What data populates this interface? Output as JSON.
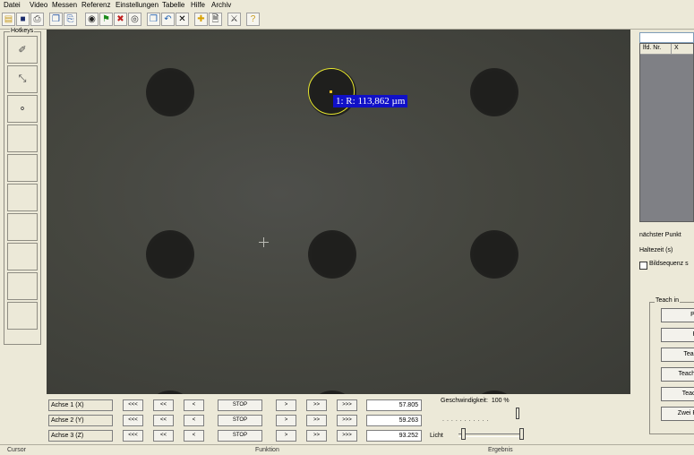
{
  "menu": [
    "Datei",
    "Video",
    "Messen",
    "Referenz",
    "Einstellungen",
    "Tabelle",
    "Hilfe",
    "Archiv"
  ],
  "toolbar_icons": [
    "open-folder-icon",
    "save-disk-icon",
    "print-icon",
    "copy-icon",
    "paste-icon",
    "camera-icon",
    "flag-icon",
    "marker-icon",
    "record-icon",
    "measure-icon",
    "undo-icon",
    "delete-x-icon",
    "crosshair-icon",
    "page-search-icon",
    "network-icon",
    "help-icon"
  ],
  "hotkeys": {
    "title": "Hotkeys",
    "buttons": [
      {
        "icon": "measure-line-icon",
        "glyph": "✐"
      },
      {
        "icon": "measure-angle-icon",
        "glyph": "⤡"
      },
      {
        "icon": "measure-points-icon",
        "glyph": "⚬"
      },
      {
        "icon": "",
        "glyph": ""
      },
      {
        "icon": "",
        "glyph": ""
      },
      {
        "icon": "",
        "glyph": ""
      },
      {
        "icon": "",
        "glyph": ""
      },
      {
        "icon": "",
        "glyph": ""
      },
      {
        "icon": "",
        "glyph": ""
      },
      {
        "icon": "",
        "glyph": ""
      }
    ]
  },
  "camera": {
    "measurement_label": "1: R: 113,862 µm",
    "overlay_color": "#e8e830",
    "label_background": "#1010c8"
  },
  "right_panel": {
    "table_headers": [
      "lfd. Nr.",
      "X"
    ],
    "next_point_label": "nächster Punkt",
    "hold_time_label": "Haltezeit (s)",
    "image_sequence_label": "Bildsequenz s",
    "teach": {
      "title": "Teach in",
      "buttons": [
        "Pur",
        "Pu",
        "Teach",
        "TeachIn",
        "Teachl",
        "Zwei Pu"
      ]
    }
  },
  "axes": [
    {
      "label": "Achse 1 (X)",
      "value": "57.805"
    },
    {
      "label": "Achse 2 (Y)",
      "value": "59.263"
    },
    {
      "label": "Achse 3 (Z)",
      "value": "93.252"
    }
  ],
  "axis_buttons": {
    "fast_back": "<<<",
    "back": "<<",
    "step_back": "<",
    "stop": "STOP",
    "step_fwd": ">",
    "fwd": ">>",
    "fast_fwd": ">>>"
  },
  "speed": {
    "label": "Geschwindigkeit:",
    "value": "100 %",
    "fraction": 1.0
  },
  "light": {
    "label": "Licht"
  },
  "status": [
    "Cursor",
    "Funktion",
    "Ergebnis"
  ]
}
